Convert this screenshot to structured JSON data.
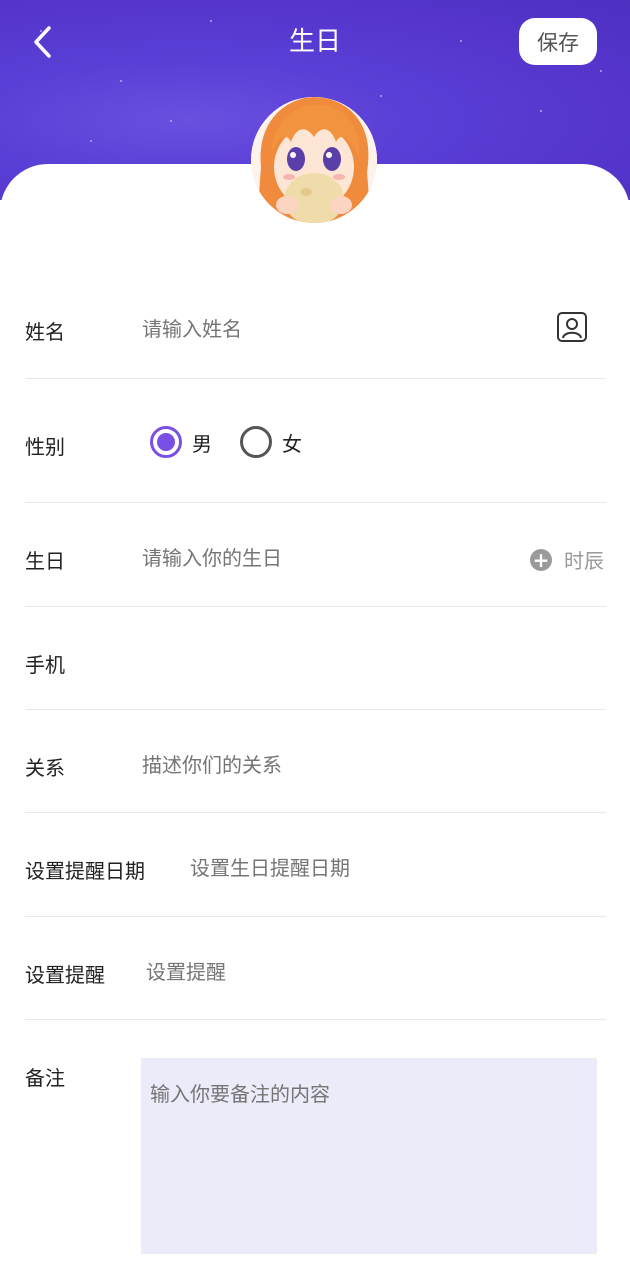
{
  "header": {
    "title": "生日",
    "save_label": "保存",
    "background_color": "#5535cc"
  },
  "avatar": {
    "description_icon": "anime-avatar"
  },
  "form": {
    "name": {
      "label": "姓名",
      "placeholder": "请输入姓名",
      "icon": "contact-card-icon"
    },
    "gender": {
      "label": "性别",
      "options": [
        {
          "label": "男",
          "checked": true
        },
        {
          "label": "女",
          "checked": false
        }
      ],
      "accent_color": "#7a4fe6"
    },
    "birthday": {
      "label": "生日",
      "placeholder": "请输入你的生日",
      "time_label": "时辰",
      "icon": "plus-circle-icon"
    },
    "phone": {
      "label": "手机",
      "value": ""
    },
    "relation": {
      "label": "关系",
      "placeholder": "描述你们的关系"
    },
    "remind_date": {
      "label": "设置提醒日期",
      "placeholder": "设置生日提醒日期"
    },
    "remind": {
      "label": "设置提醒",
      "placeholder": "设置提醒"
    },
    "note": {
      "label": "备注",
      "placeholder": "输入你要备注的内容",
      "background_color": "#ecebf9"
    }
  }
}
